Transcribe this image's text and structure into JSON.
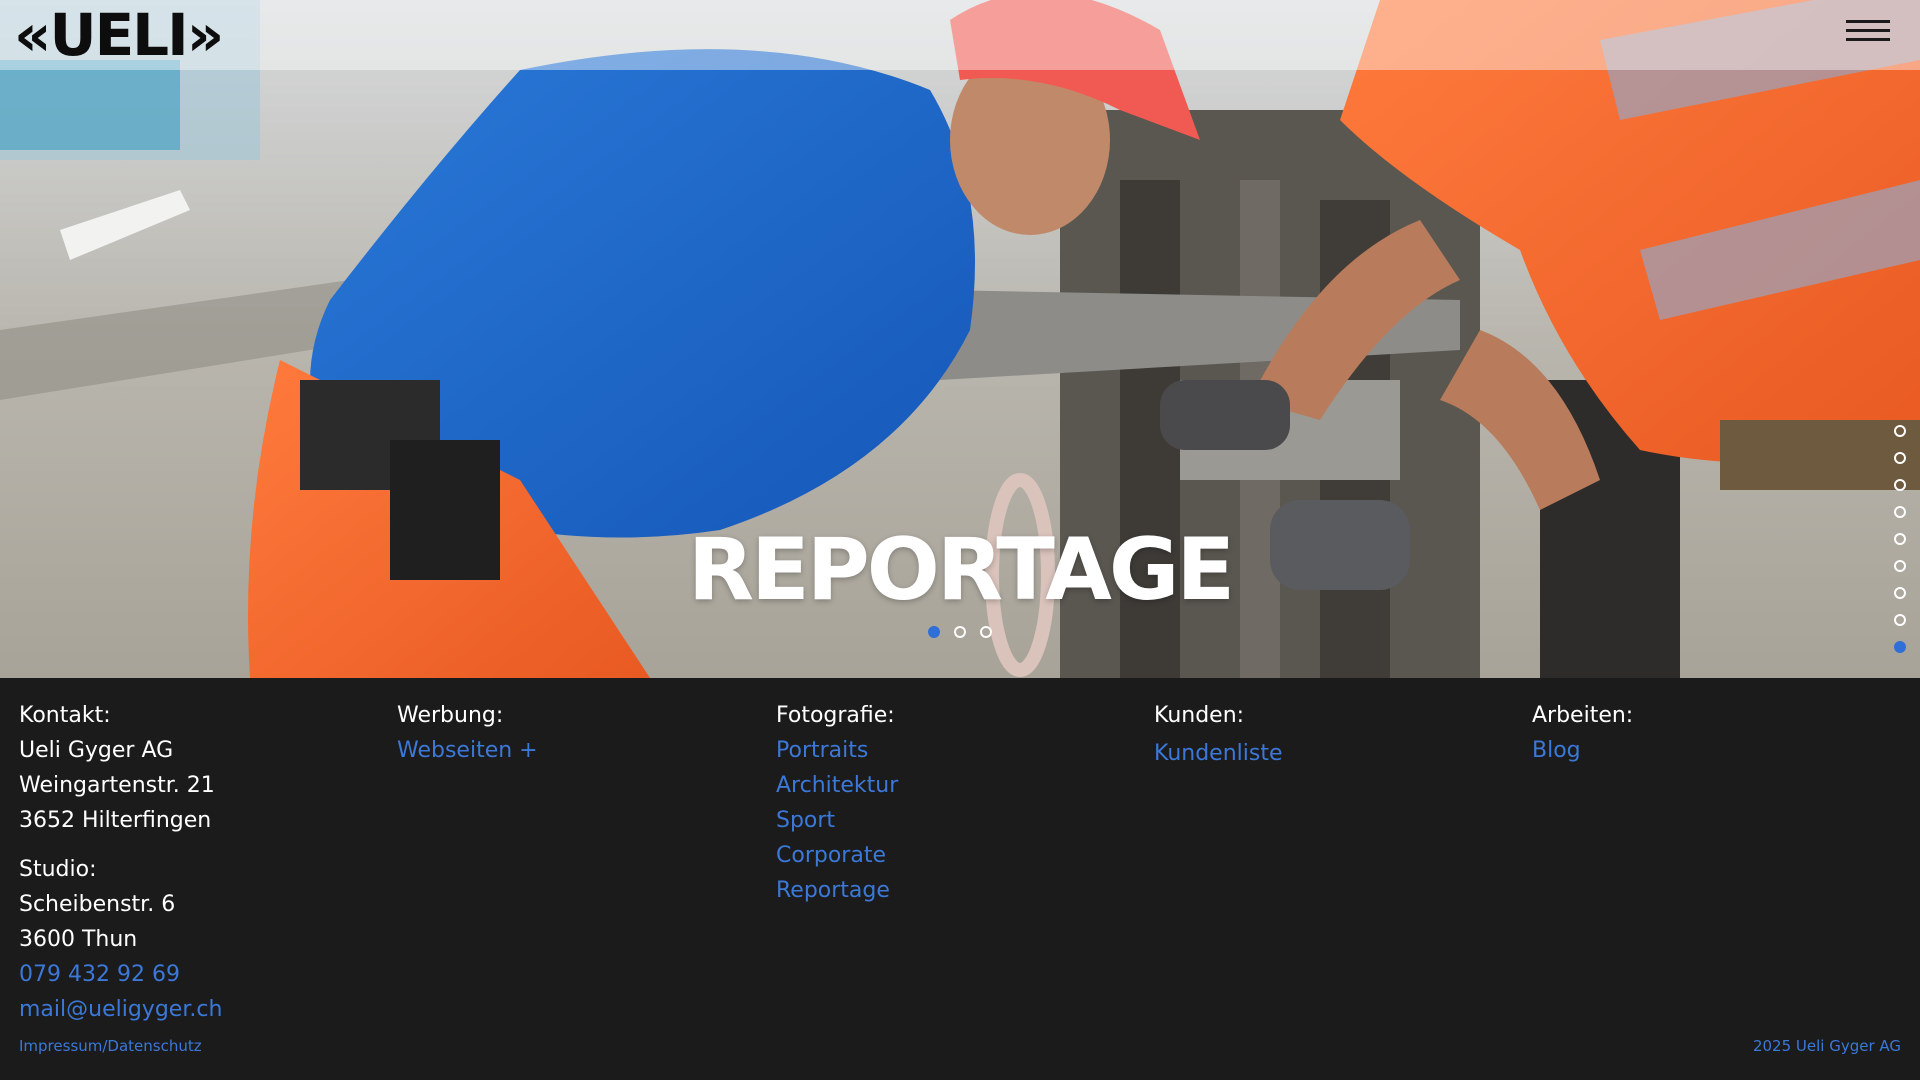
{
  "header": {
    "logo": "«UELI»",
    "menu_icon": "hamburger-menu-icon"
  },
  "hero": {
    "title": "REPORTAGE",
    "slide_dots": {
      "count": 3,
      "active": 0
    },
    "section_dots": {
      "count": 9,
      "active": 8
    }
  },
  "footer": {
    "contact": {
      "head": "Kontakt:",
      "company": "Ueli Gyger AG",
      "street": "Weingartenstr. 21",
      "city": "3652 Hilterfingen",
      "studio_head": "Studio:",
      "studio_street": "Scheibenstr. 6",
      "studio_city": "3600 Thun",
      "phone": "079 432 92 69",
      "email": "mail@ueligyger.ch"
    },
    "werbung": {
      "head": "Werbung:",
      "items": [
        "Webseiten +"
      ]
    },
    "fotografie": {
      "head": "Fotografie:",
      "items": [
        "Portraits",
        "Architektur",
        "Sport",
        "Corporate",
        "Reportage"
      ]
    },
    "kunden": {
      "head": "Kunden:",
      "items": [
        "Kundenliste"
      ]
    },
    "arbeiten": {
      "head": "Arbeiten:",
      "items": [
        "Blog"
      ]
    },
    "legal": "Impressum/Datenschutz",
    "copyright": "2025 Ueli Gyger AG"
  },
  "colors": {
    "accent": "#3b78d8",
    "active_dot": "#2f6fd6",
    "footer_bg": "#1b1b1b"
  }
}
